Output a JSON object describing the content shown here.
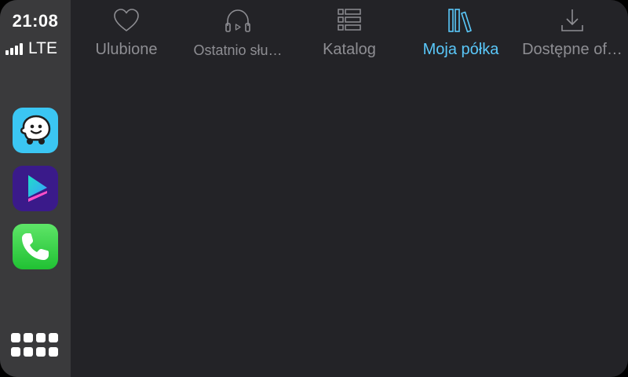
{
  "status": {
    "time": "21:08",
    "network": "LTE"
  },
  "rail": {
    "apps": [
      {
        "name": "Waze",
        "icon": "waze-icon",
        "color": "#3bc6f3"
      },
      {
        "name": "Player",
        "icon": "play-icon",
        "color": "#3a1a8a"
      },
      {
        "name": "Phone",
        "icon": "phone-icon",
        "color": "#2fd046"
      }
    ],
    "grid_icon": "app-grid-icon"
  },
  "tabs": [
    {
      "label": "Ulubione",
      "icon": "heart-icon",
      "active": false
    },
    {
      "label": "Ostatnio słu…",
      "icon": "headphones-icon",
      "active": false
    },
    {
      "label": "Katalog",
      "icon": "list-icon",
      "active": false
    },
    {
      "label": "Moja półka",
      "icon": "books-icon",
      "active": true
    },
    {
      "label": "Dostępne of…",
      "icon": "download-icon",
      "active": false
    }
  ],
  "colors": {
    "accent": "#5ac8fa",
    "inactive": "#8e8e93",
    "background": "#232327",
    "rail": "#3a3a3c"
  }
}
